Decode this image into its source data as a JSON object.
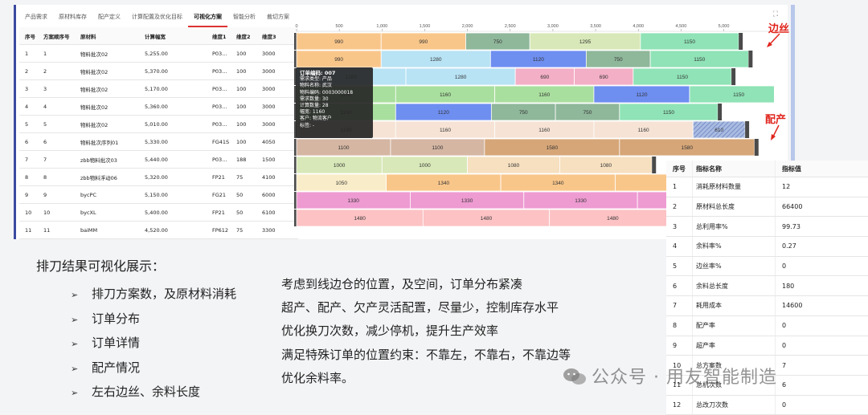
{
  "tabs": [
    "产品需求",
    "原材料库存",
    "配产定义",
    "计算配置及优化目标",
    "可视化方案",
    "智能分析",
    "裁切方案"
  ],
  "active_tab": 4,
  "table": {
    "headers": [
      "序号",
      "方案顺序号",
      "原材料",
      "计算幅宽",
      "维度1",
      "维度2",
      "维度3"
    ],
    "rows": [
      [
        "1",
        "1",
        "物料批次02",
        "5,255.00",
        "P03...",
        "100",
        "3000"
      ],
      [
        "2",
        "2",
        "物料批次02",
        "5,370.00",
        "P03...",
        "100",
        "3000"
      ],
      [
        "3",
        "3",
        "物料批次02",
        "5,170.00",
        "P03...",
        "100",
        "3000"
      ],
      [
        "4",
        "4",
        "物料批次02",
        "5,360.00",
        "P03...",
        "100",
        "3000"
      ],
      [
        "5",
        "5",
        "物料批次02",
        "5,010.00",
        "P03...",
        "100",
        "3000"
      ],
      [
        "6",
        "6",
        "物料批次序列01",
        "5,330.00",
        "FG41S",
        "100",
        "4050"
      ],
      [
        "7",
        "7",
        "zbb物料批次03",
        "5,440.00",
        "P03...",
        "188",
        "1500"
      ],
      [
        "8",
        "8",
        "zbb物料浮动06",
        "5,320.00",
        "FP21",
        "75",
        "4100"
      ],
      [
        "9",
        "9",
        "bycPC",
        "5,150.00",
        "FG21",
        "50",
        "6000"
      ],
      [
        "10",
        "10",
        "bycXL",
        "5,400.00",
        "FP21",
        "50",
        "6100"
      ],
      [
        "11",
        "11",
        "baiMM",
        "4,520.00",
        "FP612",
        "75",
        "3300"
      ]
    ]
  },
  "chart_data": {
    "type": "bar",
    "orientation": "horizontal-stacked",
    "x_ticks": [
      "0",
      "500",
      "1,000",
      "1,500",
      "2,000",
      "2,500",
      "3,000",
      "3,500",
      "4,000",
      "4,500",
      "5,000"
    ],
    "xlim": [
      0,
      5550
    ],
    "rows": [
      {
        "segments": [
          {
            "v": 990,
            "c": "#f9c68a"
          },
          {
            "v": 990,
            "c": "#f9c68a"
          },
          {
            "v": 750,
            "c": "#8fb79a"
          },
          {
            "v": 1295,
            "c": "#d8e8b8"
          },
          {
            "v": 1150,
            "c": "#8fe3b6"
          }
        ]
      },
      {
        "segments": [
          {
            "v": 990,
            "c": "#f9c68a"
          },
          {
            "v": 1280,
            "c": "#b8e3f5"
          },
          {
            "v": 1120,
            "c": "#6e8ef0"
          },
          {
            "v": 750,
            "c": "#8fb79a"
          },
          {
            "v": 1150,
            "c": "#8fe3b6"
          }
        ]
      },
      {
        "segments": [
          {
            "v": 1280,
            "c": "#b8e3f5"
          },
          {
            "v": 1280,
            "c": "#b8e3f5"
          },
          {
            "v": 690,
            "c": "#f3afc6"
          },
          {
            "v": 690,
            "c": "#f3afc6"
          },
          {
            "v": 1150,
            "c": "#8fe3b6"
          }
        ]
      },
      {
        "segments": [
          {
            "v": 1160,
            "c": "#a9df9e"
          },
          {
            "v": 1160,
            "c": "#a9df9e"
          },
          {
            "v": 1160,
            "c": "#a9df9e"
          },
          {
            "v": 1120,
            "c": "#6e8ef0"
          },
          {
            "v": 1150,
            "c": "#8fe3b6"
          }
        ]
      },
      {
        "segments": [
          {
            "v": 1160,
            "c": "#a9df9e"
          },
          {
            "v": 1120,
            "c": "#6e8ef0"
          },
          {
            "v": 750,
            "c": "#8fb79a"
          },
          {
            "v": 750,
            "c": "#8fb79a"
          },
          {
            "v": 1150,
            "c": "#8fe3b6"
          }
        ]
      },
      {
        "segments": [
          {
            "v": 1160,
            "c": "#f6e3d5"
          },
          {
            "v": 1160,
            "c": "#f6e3d5"
          },
          {
            "v": 1160,
            "c": "#f6e3d5"
          },
          {
            "v": 1160,
            "c": "#f6e3d5"
          },
          {
            "v": 610,
            "c": "#a9bbe0",
            "hatch": true
          }
        ]
      },
      {
        "segments": [
          {
            "v": 1100,
            "c": "#d4b6a3"
          },
          {
            "v": 1100,
            "c": "#d4b6a3"
          },
          {
            "v": 1580,
            "c": "#d6a678"
          },
          {
            "v": 1580,
            "c": "#d6a678"
          }
        ]
      },
      {
        "segments": [
          {
            "v": 1000,
            "c": "#d8e8b8"
          },
          {
            "v": 1000,
            "c": "#d8e8b8"
          },
          {
            "v": 1080,
            "c": "#f6e0c0"
          },
          {
            "v": 1080,
            "c": "#f6e0c0"
          }
        ]
      },
      {
        "segments": [
          {
            "v": 1050,
            "c": "#f9ecc8"
          },
          {
            "v": 1340,
            "c": "#f9c68a"
          },
          {
            "v": 1340,
            "c": "#f9c68a"
          },
          {
            "v": 1340,
            "c": "#f9c68a"
          }
        ]
      },
      {
        "segments": [
          {
            "v": 1330,
            "c": "#ee9bd2"
          },
          {
            "v": 1330,
            "c": "#ee9bd2"
          },
          {
            "v": 1330,
            "c": "#ee9bd2"
          },
          {
            "v": 1330,
            "c": "#ee9bd2"
          }
        ]
      },
      {
        "segments": [
          {
            "v": 1480,
            "c": "#fcc2c4"
          },
          {
            "v": 1480,
            "c": "#fcc2c4"
          },
          {
            "v": 1480,
            "c": "#fcc2c4"
          }
        ]
      }
    ]
  },
  "tooltip": {
    "title": "订单编码: 007",
    "lines": [
      "需求类型: 产品",
      "物料名称: 武汉",
      "物料编码: 0003000018",
      "需求数量: 30",
      "计算数量: 28",
      "幅宽: 1160",
      "客户: 物流客户",
      "标签: -"
    ]
  },
  "callouts": {
    "edge": "边丝",
    "alloc": "配产"
  },
  "metrics": {
    "headers": [
      "序号",
      "指标名称",
      "指标值"
    ],
    "rows": [
      [
        "1",
        "消耗原材料数量",
        "12"
      ],
      [
        "2",
        "原材料总长度",
        "66400"
      ],
      [
        "3",
        "总利用率%",
        "99.73"
      ],
      [
        "4",
        "余料率%",
        "0.27"
      ],
      [
        "5",
        "边丝率%",
        "0"
      ],
      [
        "6",
        "余料总长度",
        "180"
      ],
      [
        "7",
        "耗用成本",
        "14600"
      ],
      [
        "8",
        "配产率",
        "0"
      ],
      [
        "9",
        "超产率",
        "0"
      ],
      [
        "10",
        "总方案数",
        "7"
      ],
      [
        "11",
        "总机次数",
        "6"
      ],
      [
        "12",
        "总改刀次数",
        "0"
      ]
    ]
  },
  "summary": {
    "title": "排刀结果可视化展示：",
    "bullets": [
      "排刀方案数，及原材料消耗",
      "订单分布",
      "订单详情",
      "配产情况",
      "左右边丝、余料长度"
    ],
    "arrow": "➢",
    "desc": [
      "考虑到线边仓的位置，及空间，订单分布紧凑",
      "超产、配产、欠产灵活配置，尽量少，控制库存水平",
      "优化换刀次数，减少停机，提升生产效率",
      "满足特殊订单的位置约束：不靠左，不靠右，不靠边等",
      "优化余料率。"
    ]
  },
  "watermark": "公众号 · 用友智能制造"
}
